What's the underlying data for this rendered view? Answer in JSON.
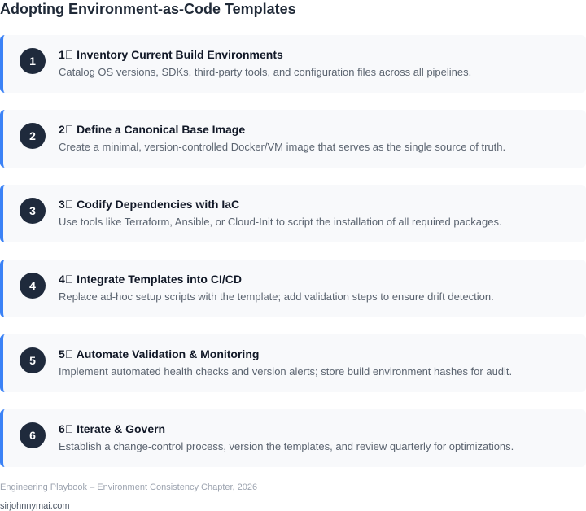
{
  "title": "Adopting Environment-as-Code Templates",
  "steps": [
    {
      "number": "1",
      "title": "1⃣ Inventory Current Build Environments",
      "description": "Catalog OS versions, SDKs, third-party tools, and configuration files across all pipelines."
    },
    {
      "number": "2",
      "title": "2⃣ Define a Canonical Base Image",
      "description": "Create a minimal, version-controlled Docker/VM image that serves as the single source of truth."
    },
    {
      "number": "3",
      "title": "3⃣ Codify Dependencies with IaC",
      "description": "Use tools like Terraform, Ansible, or Cloud-Init to script the installation of all required packages."
    },
    {
      "number": "4",
      "title": "4⃣ Integrate Templates into CI/CD",
      "description": "Replace ad-hoc setup scripts with the template; add validation steps to ensure drift detection."
    },
    {
      "number": "5",
      "title": "5⃣ Automate Validation & Monitoring",
      "description": "Implement automated health checks and version alerts; store build environment hashes for audit."
    },
    {
      "number": "6",
      "title": "6⃣ Iterate & Govern",
      "description": "Establish a change-control process, version the templates, and review quarterly for optimizations."
    }
  ],
  "footer": {
    "note": "Engineering Playbook – Environment Consistency Chapter, 2026",
    "site": "sirjohnnymai.com"
  },
  "colors": {
    "accent": "#3b82f6",
    "badge": "#1f2a3c",
    "card_background": "#f8f9fb"
  }
}
